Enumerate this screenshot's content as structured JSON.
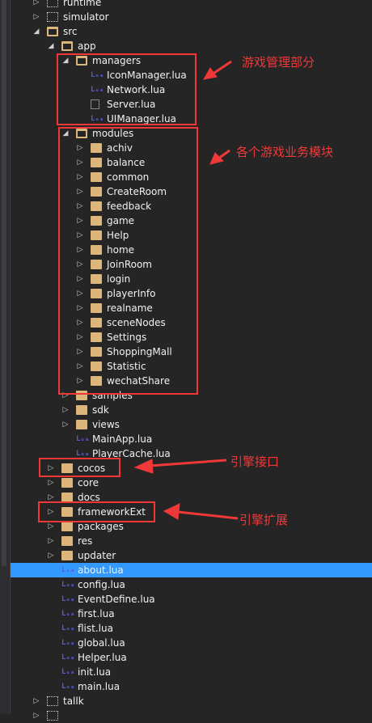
{
  "colors": {
    "background": "#252526",
    "selection": "#3399ff",
    "folder": "#dcb67a",
    "annotation": "#f03838",
    "lua_icon": "#5b5bd6"
  },
  "tree": [
    {
      "label": "runtime",
      "level": 0,
      "icon": "project-folder-icon",
      "expander": "collapsed"
    },
    {
      "label": "simulator",
      "level": 0,
      "icon": "project-folder-icon",
      "expander": "collapsed"
    },
    {
      "label": "src",
      "level": 0,
      "icon": "folder-open-icon",
      "expander": "expanded"
    },
    {
      "label": "app",
      "level": 1,
      "icon": "folder-open-icon",
      "expander": "expanded"
    },
    {
      "label": "managers",
      "level": 2,
      "icon": "folder-open-icon",
      "expander": "expanded"
    },
    {
      "label": "IconManager.lua",
      "level": 3,
      "icon": "lua-file-icon",
      "expander": "none"
    },
    {
      "label": "Network.lua",
      "level": 3,
      "icon": "lua-file-icon",
      "expander": "none"
    },
    {
      "label": "Server.lua",
      "level": 3,
      "icon": "file-icon",
      "expander": "none"
    },
    {
      "label": "UIManager.lua",
      "level": 3,
      "icon": "lua-file-icon",
      "expander": "none"
    },
    {
      "label": "modules",
      "level": 2,
      "icon": "folder-open-icon",
      "expander": "expanded"
    },
    {
      "label": "achiv",
      "level": 3,
      "icon": "folder-icon",
      "expander": "collapsed"
    },
    {
      "label": "balance",
      "level": 3,
      "icon": "folder-icon",
      "expander": "collapsed"
    },
    {
      "label": "common",
      "level": 3,
      "icon": "folder-icon",
      "expander": "collapsed"
    },
    {
      "label": "CreateRoom",
      "level": 3,
      "icon": "folder-icon",
      "expander": "collapsed"
    },
    {
      "label": "feedback",
      "level": 3,
      "icon": "folder-icon",
      "expander": "collapsed"
    },
    {
      "label": "game",
      "level": 3,
      "icon": "folder-icon",
      "expander": "collapsed"
    },
    {
      "label": "Help",
      "level": 3,
      "icon": "folder-icon",
      "expander": "collapsed"
    },
    {
      "label": "home",
      "level": 3,
      "icon": "folder-icon",
      "expander": "collapsed"
    },
    {
      "label": "JoinRoom",
      "level": 3,
      "icon": "folder-icon",
      "expander": "collapsed"
    },
    {
      "label": "login",
      "level": 3,
      "icon": "folder-icon",
      "expander": "collapsed"
    },
    {
      "label": "playerInfo",
      "level": 3,
      "icon": "folder-icon",
      "expander": "collapsed"
    },
    {
      "label": "realname",
      "level": 3,
      "icon": "folder-icon",
      "expander": "collapsed"
    },
    {
      "label": "sceneNodes",
      "level": 3,
      "icon": "folder-icon",
      "expander": "collapsed"
    },
    {
      "label": "Settings",
      "level": 3,
      "icon": "folder-icon",
      "expander": "collapsed"
    },
    {
      "label": "ShoppingMall",
      "level": 3,
      "icon": "folder-icon",
      "expander": "collapsed"
    },
    {
      "label": "Statistic",
      "level": 3,
      "icon": "folder-icon",
      "expander": "collapsed"
    },
    {
      "label": "wechatShare",
      "level": 3,
      "icon": "folder-icon",
      "expander": "collapsed"
    },
    {
      "label": "samples",
      "level": 2,
      "icon": "folder-icon",
      "expander": "collapsed"
    },
    {
      "label": "sdk",
      "level": 2,
      "icon": "folder-icon",
      "expander": "collapsed"
    },
    {
      "label": "views",
      "level": 2,
      "icon": "folder-icon",
      "expander": "collapsed"
    },
    {
      "label": "MainApp.lua",
      "level": 2,
      "icon": "lua-file-icon",
      "expander": "none"
    },
    {
      "label": "PlayerCache.lua",
      "level": 2,
      "icon": "lua-file-icon",
      "expander": "none"
    },
    {
      "label": "cocos",
      "level": 1,
      "icon": "folder-icon",
      "expander": "collapsed"
    },
    {
      "label": "core",
      "level": 1,
      "icon": "folder-icon",
      "expander": "collapsed"
    },
    {
      "label": "docs",
      "level": 1,
      "icon": "folder-icon",
      "expander": "collapsed"
    },
    {
      "label": "frameworkExt",
      "level": 1,
      "icon": "folder-icon",
      "expander": "collapsed"
    },
    {
      "label": "packages",
      "level": 1,
      "icon": "folder-icon",
      "expander": "collapsed"
    },
    {
      "label": "res",
      "level": 1,
      "icon": "folder-icon",
      "expander": "collapsed"
    },
    {
      "label": "updater",
      "level": 1,
      "icon": "folder-icon",
      "expander": "collapsed"
    },
    {
      "label": "about.lua",
      "level": 1,
      "icon": "lua-file-icon",
      "expander": "none",
      "selected": true
    },
    {
      "label": "config.lua",
      "level": 1,
      "icon": "lua-file-icon",
      "expander": "none"
    },
    {
      "label": "EventDefine.lua",
      "level": 1,
      "icon": "lua-file-icon",
      "expander": "none"
    },
    {
      "label": "first.lua",
      "level": 1,
      "icon": "lua-file-icon",
      "expander": "none"
    },
    {
      "label": "flist.lua",
      "level": 1,
      "icon": "lua-file-icon",
      "expander": "none"
    },
    {
      "label": "global.lua",
      "level": 1,
      "icon": "lua-file-icon",
      "expander": "none"
    },
    {
      "label": "Helper.lua",
      "level": 1,
      "icon": "lua-file-icon",
      "expander": "none"
    },
    {
      "label": "init.lua",
      "level": 1,
      "icon": "lua-file-icon",
      "expander": "none"
    },
    {
      "label": "main.lua",
      "level": 1,
      "icon": "lua-file-icon",
      "expander": "none"
    },
    {
      "label": "tallk",
      "level": 0,
      "icon": "project-folder-icon",
      "expander": "collapsed"
    },
    {
      "label": "",
      "level": 0,
      "icon": "project-folder-icon",
      "expander": "collapsed"
    }
  ],
  "annotations": {
    "managers": "游戏管理部分",
    "modules": "各个游戏业务模块",
    "cocos": "引擎接口",
    "frameworkExt": "引擎扩展"
  }
}
